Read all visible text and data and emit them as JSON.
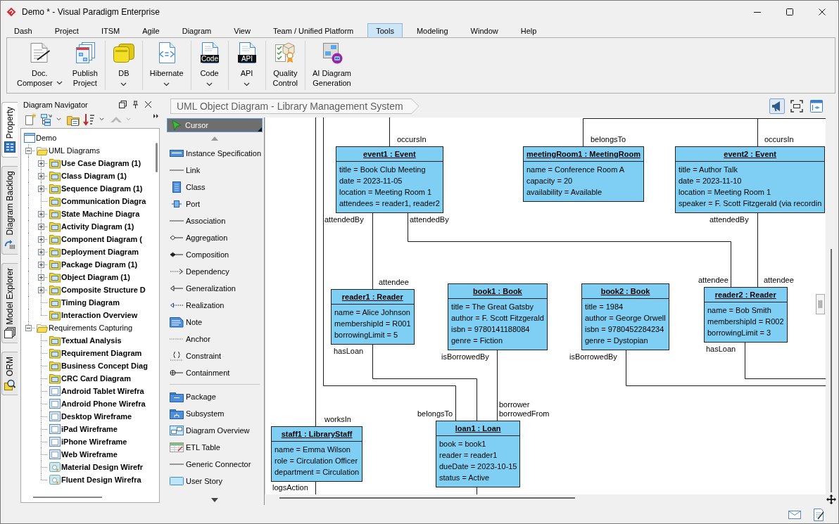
{
  "window": {
    "title": "Demo * - Visual Paradigm Enterprise"
  },
  "menu_tabs": [
    {
      "label": "Dash",
      "selected": false
    },
    {
      "label": "Project",
      "selected": false
    },
    {
      "label": "ITSM",
      "selected": false
    },
    {
      "label": "Agile",
      "selected": false
    },
    {
      "label": "Diagram",
      "selected": false
    },
    {
      "label": "View",
      "selected": false
    },
    {
      "label": "Team / Unified Platform",
      "selected": false
    },
    {
      "label": "Tools",
      "selected": true
    },
    {
      "label": "Modeling",
      "selected": false
    },
    {
      "label": "Window",
      "selected": false
    },
    {
      "label": "Help",
      "selected": false
    }
  ],
  "ribbon": {
    "groups": [
      {
        "buttons": [
          {
            "lines": [
              "Doc.",
              "Composer"
            ],
            "dropdown": true
          },
          {
            "lines": [
              "Publish",
              "Project"
            ],
            "dropdown": false
          }
        ]
      },
      {
        "buttons": [
          {
            "lines": [
              "DB"
            ],
            "dropdown": true
          }
        ]
      },
      {
        "buttons": [
          {
            "lines": [
              "Hibernate"
            ],
            "dropdown": true
          }
        ]
      },
      {
        "buttons": [
          {
            "lines": [
              "Code"
            ],
            "dropdown": true,
            "icon_text": "Code"
          }
        ]
      },
      {
        "buttons": [
          {
            "lines": [
              "API"
            ],
            "dropdown": true,
            "icon_text": "API"
          }
        ]
      },
      {
        "buttons": [
          {
            "lines": [
              "Quality",
              "Control"
            ],
            "dropdown": false
          }
        ]
      },
      {
        "buttons": [
          {
            "lines": [
              "AI Diagram",
              "Generation"
            ],
            "dropdown": false
          }
        ]
      }
    ]
  },
  "side_tabs": [
    {
      "label": "Property",
      "selected": true
    },
    {
      "label": "Diagram Backlog",
      "selected": false
    },
    {
      "label": "Model Explorer",
      "selected": false
    },
    {
      "label": "ORM",
      "selected": false
    }
  ],
  "navigator": {
    "title": "Diagram Navigator",
    "toolbar": [
      {
        "dropdown": false,
        "disabled": false
      },
      {
        "dropdown": true,
        "disabled": false
      },
      {
        "dropdown": false,
        "disabled": false
      },
      {
        "dropdown": true,
        "disabled": false
      },
      {
        "dropdown": true,
        "disabled": true
      }
    ],
    "tree": [
      {
        "label": "Demo",
        "kind": "project",
        "children": [
          {
            "label": "UML Diagrams",
            "kind": "folder",
            "expanded": true,
            "children": [
              {
                "label": "Use Case Diagram (1)",
                "kind": "diagram",
                "expanded": false
              },
              {
                "label": "Class Diagram (1)",
                "kind": "diagram",
                "expanded": false
              },
              {
                "label": "Sequence Diagram (1)",
                "kind": "diagram",
                "expanded": false
              },
              {
                "label": "Communication Diagra",
                "kind": "diagram"
              },
              {
                "label": "State Machine Diagra",
                "kind": "diagram",
                "expanded": false
              },
              {
                "label": "Activity Diagram (1)",
                "kind": "diagram",
                "expanded": false
              },
              {
                "label": "Component Diagram (",
                "kind": "diagram",
                "expanded": false
              },
              {
                "label": "Deployment Diagram",
                "kind": "diagram",
                "expanded": false
              },
              {
                "label": "Package Diagram (1)",
                "kind": "diagram",
                "expanded": false
              },
              {
                "label": "Object Diagram (1)",
                "kind": "diagram",
                "expanded": false
              },
              {
                "label": "Composite Structure D",
                "kind": "diagram",
                "expanded": false
              },
              {
                "label": "Timing Diagram",
                "kind": "diagram"
              },
              {
                "label": "Interaction Overview",
                "kind": "diagram"
              }
            ]
          },
          {
            "label": "Requirements Capturing",
            "kind": "folder",
            "expanded": true,
            "children": [
              {
                "label": "Textual Analysis",
                "kind": "diagram"
              },
              {
                "label": "Requirement Diagram",
                "kind": "diagram"
              },
              {
                "label": "Business Concept Diag",
                "kind": "diagram"
              },
              {
                "label": "CRC Card Diagram",
                "kind": "diagram"
              },
              {
                "label": "Android Tablet Wirefra",
                "kind": "wireframe"
              },
              {
                "label": "Android Phone Wirefra",
                "kind": "wireframe"
              },
              {
                "label": "Desktop Wireframe",
                "kind": "wireframe"
              },
              {
                "label": "iPad Wireframe",
                "kind": "wireframe"
              },
              {
                "label": "iPhone Wireframe",
                "kind": "wireframe"
              },
              {
                "label": "Web Wireframe",
                "kind": "wireframe"
              },
              {
                "label": "Material Design Wirefr",
                "kind": "design-wireframe"
              },
              {
                "label": "Fluent Design Wirefra",
                "kind": "design-wireframe"
              }
            ]
          }
        ]
      }
    ]
  },
  "diagram": {
    "breadcrumb": "UML Object Diagram - Library Management System",
    "view_toggles": [
      {
        "on": true
      },
      {
        "on": false
      },
      {
        "on": false
      }
    ],
    "palette": {
      "cursor": {
        "label": "Cursor",
        "selected": true
      },
      "groups": [
        {
          "tools": [
            {
              "label": "Instance Specification",
              "selected": false
            },
            {
              "label": "Link",
              "selected": false
            },
            {
              "label": "Class",
              "selected": false
            },
            {
              "label": "Port",
              "selected": false
            },
            {
              "label": "Association",
              "selected": false
            },
            {
              "label": "Aggregation",
              "selected": false
            },
            {
              "label": "Composition",
              "selected": false
            },
            {
              "label": "Dependency",
              "selected": false
            },
            {
              "label": "Generalization",
              "selected": false
            },
            {
              "label": "Realization",
              "selected": false
            },
            {
              "label": "Note",
              "selected": false
            },
            {
              "label": "Anchor",
              "selected": false
            },
            {
              "label": "Constraint",
              "selected": false
            },
            {
              "label": "Containment",
              "selected": false
            }
          ]
        },
        {
          "tools": [
            {
              "label": "Package",
              "selected": false
            },
            {
              "label": "Subsystem",
              "selected": false
            },
            {
              "label": "Diagram Overview",
              "selected": false
            },
            {
              "label": "ETL Table",
              "selected": false
            },
            {
              "label": "Generic Connector",
              "selected": false
            },
            {
              "label": "User Story",
              "selected": false
            }
          ]
        }
      ]
    },
    "objects": [
      {
        "name": "event1 : Event",
        "attributes": [
          "title = Book Club Meeting",
          "date = 2023-11-05",
          "location = Meeting Room 1",
          "attendees = reader1, reader2"
        ]
      },
      {
        "name": "meetingRoom1 : MeetingRoom",
        "attributes": [
          "name = Conference Room A",
          "capacity = 20",
          "availability = Available"
        ]
      },
      {
        "name": "event2 : Event",
        "attributes": [
          "title = Author Talk",
          "date = 2023-11-10",
          "location = Meeting Room 1",
          "speaker = F. Scott Fitzgerald (via recordin"
        ]
      },
      {
        "name": "reader1 : Reader",
        "attributes": [
          "name = Alice Johnson",
          "membershipId = R001",
          "borrowingLimit = 5"
        ]
      },
      {
        "name": "book1 : Book",
        "attributes": [
          "title = The Great Gatsby",
          "author = F. Scott Fitzgerald",
          "isbn = 9780141188084",
          "genre = Fiction"
        ]
      },
      {
        "name": "book2 : Book",
        "attributes": [
          "title = 1984",
          "author = George Orwell",
          "isbn = 9780452284234",
          "genre = Dystopian"
        ]
      },
      {
        "name": "reader2 : Reader",
        "attributes": [
          "name = Bob Smith",
          "membershipId = R002",
          "borrowingLimit = 3"
        ]
      },
      {
        "name": "staff1 : LibraryStaff",
        "attributes": [
          "name = Emma Wilson",
          "role = Circulation Officer",
          "department = Circulation"
        ]
      },
      {
        "name": "loan1 : Loan",
        "attributes": [
          "book = book1",
          "reader = reader1",
          "dueDate = 2023-10-15",
          "status = Active"
        ]
      }
    ],
    "role_labels": [
      "occursIn",
      "belongsTo",
      "occursIn",
      "attendedBy",
      "attendedBy",
      "attendedBy",
      "attendee",
      "attendee",
      "attendee",
      "hasLoan",
      "isBorrowedBy",
      "isBorrowedBy",
      "hasLoan",
      "worksIn",
      "belongsTo",
      "borrower",
      "borrowedFrom",
      "logsAction"
    ]
  }
}
